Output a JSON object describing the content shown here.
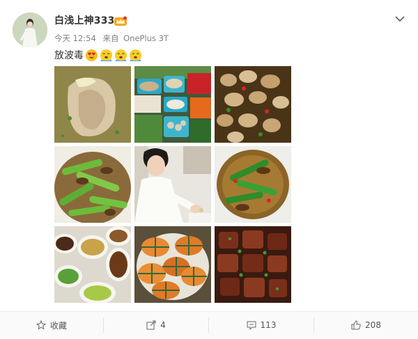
{
  "post": {
    "username": "白浅上神333",
    "time": "今天 12:54",
    "source_prefix": "来自",
    "device": "OnePlus 3T",
    "text": "放波毒"
  },
  "badges": {
    "vip": "vip-crown-icon"
  },
  "emojis": [
    "heart-eyes-emoji",
    "drooling-emoji",
    "drooling-emoji",
    "drooling-emoji"
  ],
  "photos": [
    "food-photo-braised-chicken",
    "market-photo-mushroom-stall",
    "food-photo-mushroom-stirfry",
    "food-photo-celery-beef",
    "person-photo-man-cooking",
    "food-photo-green-pepper-beef",
    "food-photo-table-spread",
    "food-photo-steamed-crabs",
    "food-photo-braised-pork"
  ],
  "actions": {
    "favorite_label": "收藏",
    "share_count": "4",
    "comment_count": "113",
    "like_count": "208"
  },
  "colors": {
    "text": "#333333",
    "meta": "#808080",
    "action_bar": "#fafafa"
  }
}
